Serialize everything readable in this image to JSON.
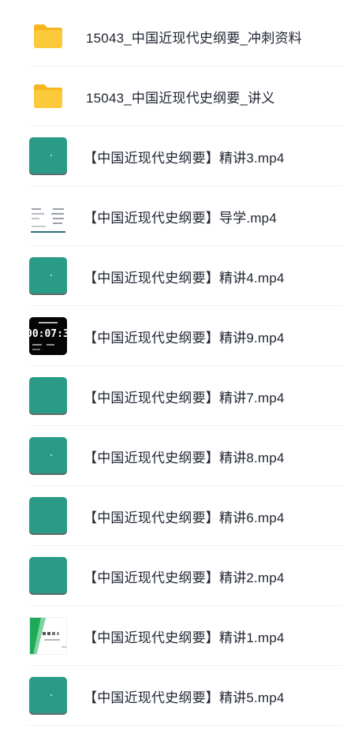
{
  "files": [
    {
      "name": "15043_中国近现代史纲要_冲刺资料",
      "icon": "folder-icon"
    },
    {
      "name": "15043_中国近现代史纲要_讲义",
      "icon": "folder-icon"
    },
    {
      "name": "【中国近现代史纲要】精讲3.mp4",
      "icon": "video-thumbnail"
    },
    {
      "name": "【中国近现代史纲要】导学.mp4",
      "icon": "video-thumbnail"
    },
    {
      "name": "【中国近现代史纲要】精讲4.mp4",
      "icon": "video-thumbnail"
    },
    {
      "name": "【中国近现代史纲要】精讲9.mp4",
      "icon": "video-thumbnail",
      "thumb_text": "00:07:3"
    },
    {
      "name": "【中国近现代史纲要】精讲7.mp4",
      "icon": "video-thumbnail"
    },
    {
      "name": "【中国近现代史纲要】精讲8.mp4",
      "icon": "video-thumbnail"
    },
    {
      "name": "【中国近现代史纲要】精讲6.mp4",
      "icon": "video-thumbnail"
    },
    {
      "name": "【中国近现代史纲要】精讲2.mp4",
      "icon": "video-thumbnail"
    },
    {
      "name": "【中国近现代史纲要】精讲1.mp4",
      "icon": "video-thumbnail"
    },
    {
      "name": "【中国近现代史纲要】精讲5.mp4",
      "icon": "video-thumbnail"
    }
  ],
  "colors": {
    "folder": "#fbc531",
    "video_tile": "#2a9b86",
    "text": "#1f2430",
    "divider": "#f1f2f5"
  }
}
